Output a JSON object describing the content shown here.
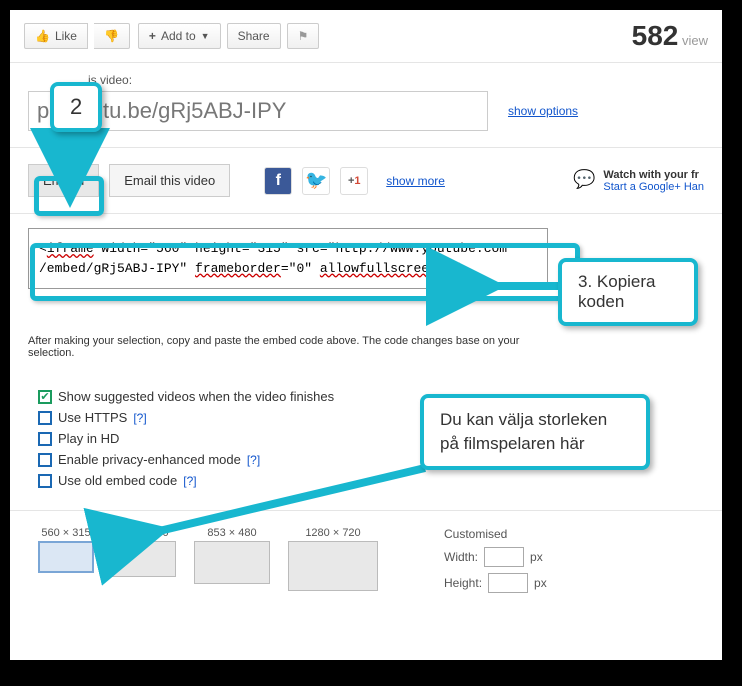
{
  "action_bar": {
    "like": "Like",
    "add_to": "Add to",
    "share": "Share",
    "views_num": "582",
    "views_label": "view"
  },
  "link_section": {
    "label": "is video:",
    "url": "p://youtu.be/gRj5ABJ-IPY",
    "show_options": "show options"
  },
  "tabs": {
    "embed": "Embed",
    "email": "Email this video",
    "show_more": "show more",
    "watch_l1": "Watch with your fr",
    "watch_l2": "Start a Google+ Han"
  },
  "embed": {
    "line1": "<iframe width=\"560\" height=\"315\" src=\"http://www.youtube.com",
    "line2": "/embed/gRj5ABJ-IPY\" frameborder=\"0\" allowfullscreen></",
    "iframe_attr": "iframe",
    "frameborder_attr": "frameborder",
    "allow_attr": "allowfullscreen",
    "note": "After making your selection, copy and paste the embed code above. The code changes base on your selection."
  },
  "options": {
    "suggested": "Show suggested videos when the video finishes",
    "https": "Use HTTPS",
    "hd": "Play in HD",
    "privacy": "Enable privacy-enhanced mode",
    "old": "Use old embed code",
    "help": "[?]"
  },
  "sizes": {
    "s1": "560 × 315",
    "s2": "640 × 360",
    "s3": "853 × 480",
    "s4": "1280 × 720",
    "custom": "Customised",
    "width": "Width:",
    "height": "Height:",
    "px": "px"
  },
  "callouts": {
    "c2": "2",
    "c3": "3. Kopiera koden",
    "c4": "Du kan välja storleken på filmspelaren här"
  }
}
